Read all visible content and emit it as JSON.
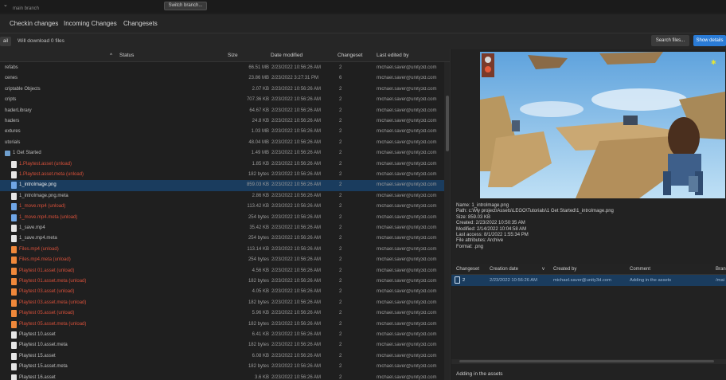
{
  "topbar": {
    "branch_sub": "main branch",
    "switch_branch": "Switch branch..."
  },
  "tabs": [
    "Checkin changes",
    "Incoming Changes",
    "Changesets"
  ],
  "toolbar": {
    "chip": "ail",
    "download_status": "Will download 0 files",
    "search_files": "Search files...",
    "show_details": "Show details"
  },
  "columns": {
    "sort": "^",
    "status": "Status",
    "size": "Size",
    "date_modified": "Date modified",
    "changeset": "Changeset",
    "last_edited_by": "Last edited by"
  },
  "rows": [
    {
      "name": "refabs",
      "size": "66.51 MB",
      "date": "2/23/2022 10:56:26 AM",
      "cs": "2",
      "by": "michael.saver@unity3d.com",
      "icon": "none",
      "color": "normal"
    },
    {
      "name": "cenes",
      "size": "23.86 MB",
      "date": "2/23/2022 3:27:31 PM",
      "cs": "6",
      "by": "michael.saver@unity3d.com",
      "icon": "none",
      "color": "normal"
    },
    {
      "name": "criptable Objects",
      "size": "2.07 KB",
      "date": "2/23/2022 10:56:26 AM",
      "cs": "2",
      "by": "michael.saver@unity3d.com",
      "icon": "none",
      "color": "normal"
    },
    {
      "name": "cripts",
      "size": "707.36 KB",
      "date": "2/23/2022 10:56:26 AM",
      "cs": "2",
      "by": "michael.saver@unity3d.com",
      "icon": "none",
      "color": "normal"
    },
    {
      "name": "haderLibrary",
      "size": "64.67 KB",
      "date": "2/23/2022 10:56:26 AM",
      "cs": "2",
      "by": "michael.saver@unity3d.com",
      "icon": "none",
      "color": "normal"
    },
    {
      "name": "haders",
      "size": "24.8 KB",
      "date": "2/23/2022 10:56:26 AM",
      "cs": "2",
      "by": "michael.saver@unity3d.com",
      "icon": "none",
      "color": "normal"
    },
    {
      "name": "extures",
      "size": "1.03 MB",
      "date": "2/23/2022 10:56:26 AM",
      "cs": "2",
      "by": "michael.saver@unity3d.com",
      "icon": "none",
      "color": "normal"
    },
    {
      "name": "utorials",
      "size": "48.04 MB",
      "date": "2/23/2022 10:56:26 AM",
      "cs": "2",
      "by": "michael.saver@unity3d.com",
      "icon": "none",
      "color": "normal"
    },
    {
      "name": "1 Get Started",
      "size": "1.49 MB",
      "date": "2/23/2022 10:56:26 AM",
      "cs": "2",
      "by": "michael.saver@unity3d.com",
      "icon": "folder",
      "color": "normal"
    },
    {
      "name": "1.Playtest.asset (unload)",
      "size": "1.85 KB",
      "date": "2/23/2022 10:56:26 AM",
      "cs": "2",
      "by": "michael.saver@unity3d.com",
      "icon": "white",
      "color": "red"
    },
    {
      "name": "1.Playtest.asset.meta (unload)",
      "size": "182 bytes",
      "date": "2/23/2022 10:56:26 AM",
      "cs": "2",
      "by": "michael.saver@unity3d.com",
      "icon": "white",
      "color": "red"
    },
    {
      "name": "1_introImage.png",
      "size": "859.03 KB",
      "date": "2/23/2022 10:56:26 AM",
      "cs": "2",
      "by": "michael.saver@unity3d.com",
      "icon": "blue",
      "color": "selected"
    },
    {
      "name": "1_introImage.png.meta",
      "size": "2.86 KB",
      "date": "2/23/2022 10:56:26 AM",
      "cs": "2",
      "by": "michael.saver@unity3d.com",
      "icon": "white",
      "color": "normal"
    },
    {
      "name": "1_move.mp4 (unload)",
      "size": "113.42 KB",
      "date": "2/23/2022 10:56:26 AM",
      "cs": "2",
      "by": "michael.saver@unity3d.com",
      "icon": "blue",
      "color": "red"
    },
    {
      "name": "1_move.mp4.meta (unload)",
      "size": "254 bytes",
      "date": "2/23/2022 10:56:26 AM",
      "cs": "2",
      "by": "michael.saver@unity3d.com",
      "icon": "blue",
      "color": "red"
    },
    {
      "name": "1_save.mp4",
      "size": "35.42 KB",
      "date": "2/23/2022 10:56:26 AM",
      "cs": "2",
      "by": "michael.saver@unity3d.com",
      "icon": "white",
      "color": "normal"
    },
    {
      "name": "1_save.mp4.meta",
      "size": "254 bytes",
      "date": "2/23/2022 10:56:26 AM",
      "cs": "2",
      "by": "michael.saver@unity3d.com",
      "icon": "white",
      "color": "normal"
    },
    {
      "name": "Files.mp4 (unload)",
      "size": "113.14 KB",
      "date": "2/23/2022 10:56:26 AM",
      "cs": "2",
      "by": "michael.saver@unity3d.com",
      "icon": "orange",
      "color": "red"
    },
    {
      "name": "Files.mp4.meta (unload)",
      "size": "254 bytes",
      "date": "2/23/2022 10:56:26 AM",
      "cs": "2",
      "by": "michael.saver@unity3d.com",
      "icon": "orange",
      "color": "red"
    },
    {
      "name": "Playtest 01.asset (unload)",
      "size": "4.56 KB",
      "date": "2/23/2022 10:56:26 AM",
      "cs": "2",
      "by": "michael.saver@unity3d.com",
      "icon": "orange",
      "color": "red"
    },
    {
      "name": "Playtest 01.asset.meta (unload)",
      "size": "182 bytes",
      "date": "2/23/2022 10:56:26 AM",
      "cs": "2",
      "by": "michael.saver@unity3d.com",
      "icon": "orange",
      "color": "red"
    },
    {
      "name": "Playtest 03.asset (unload)",
      "size": "4.05 KB",
      "date": "2/23/2022 10:56:26 AM",
      "cs": "2",
      "by": "michael.saver@unity3d.com",
      "icon": "orange",
      "color": "red"
    },
    {
      "name": "Playtest 03.asset.meta (unload)",
      "size": "182 bytes",
      "date": "2/23/2022 10:56:26 AM",
      "cs": "2",
      "by": "michael.saver@unity3d.com",
      "icon": "orange",
      "color": "red"
    },
    {
      "name": "Playtest 05.asset (unload)",
      "size": "5.96 KB",
      "date": "2/23/2022 10:56:26 AM",
      "cs": "2",
      "by": "michael.saver@unity3d.com",
      "icon": "orange",
      "color": "red"
    },
    {
      "name": "Playtest 05.asset.meta (unload)",
      "size": "182 bytes",
      "date": "2/23/2022 10:56:26 AM",
      "cs": "2",
      "by": "michael.saver@unity3d.com",
      "icon": "orange",
      "color": "red"
    },
    {
      "name": "Playtest 10.asset",
      "size": "6.41 KB",
      "date": "2/23/2022 10:56:26 AM",
      "cs": "2",
      "by": "michael.saver@unity3d.com",
      "icon": "white",
      "color": "normal"
    },
    {
      "name": "Playtest 10.asset.meta",
      "size": "182 bytes",
      "date": "2/23/2022 10:56:26 AM",
      "cs": "2",
      "by": "michael.saver@unity3d.com",
      "icon": "white",
      "color": "normal"
    },
    {
      "name": "Playtest 15.asset",
      "size": "6.08 KB",
      "date": "2/23/2022 10:56:26 AM",
      "cs": "2",
      "by": "michael.saver@unity3d.com",
      "icon": "white",
      "color": "normal"
    },
    {
      "name": "Playtest 15.asset.meta",
      "size": "182 bytes",
      "date": "2/23/2022 10:56:26 AM",
      "cs": "2",
      "by": "michael.saver@unity3d.com",
      "icon": "white",
      "color": "normal"
    },
    {
      "name": "Playtest 16.asset",
      "size": "3.6 KB",
      "date": "2/23/2022 10:56:26 AM",
      "cs": "2",
      "by": "michael.saver@unity3d.com",
      "icon": "white",
      "color": "normal"
    }
  ],
  "details": {
    "name": "Name: 1_introImage.png",
    "path": "Path: c:\\My project\\Assets\\LEGO\\Tutorials\\1 Get Started\\1_introImage.png",
    "size": "Size: 859.03 KB",
    "created": "Created: 2/23/2022 10:50:35 AM",
    "modified": "Modified: 2/14/2022 10:04:58 AM",
    "last_access": "Last access: 8/1/2022 1:55:34 PM",
    "attributes": "File attributes: Archive",
    "format": "Format: .png"
  },
  "changesets": {
    "headers": [
      "Changeset",
      "Creation date",
      "Created by",
      "Comment",
      "Bran"
    ],
    "sort": "v",
    "row": {
      "id": "2",
      "date": "2/23/2022 10:56:26 AM",
      "by": "michael.saver@unity3d.com",
      "comment": "Adding in the assets",
      "branch": "/mai"
    },
    "comment_text": "Adding in the assets"
  }
}
